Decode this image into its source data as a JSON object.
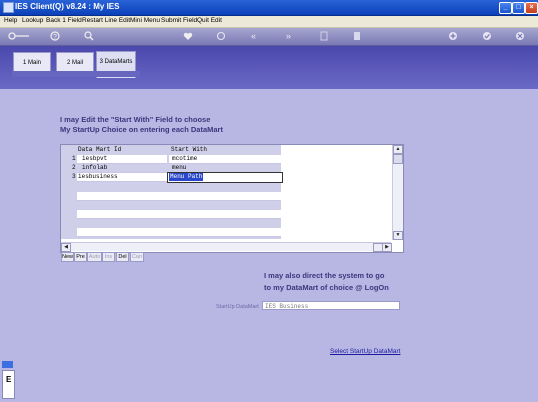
{
  "window": {
    "title": "IES Client(Q) v8.24 : My IES",
    "controls": {
      "minimize": "_",
      "maximize": "□",
      "close": "×"
    }
  },
  "menubar": {
    "items": [
      "Help",
      "Lookup",
      "Back 1 Field",
      "Restart Line Edit",
      "Mini Menu",
      "Submit Field",
      "Quit Edit"
    ]
  },
  "toolbar": {
    "icons": [
      "key-icon",
      "help-icon",
      "search-icon",
      "heart-icon",
      "refresh-icon",
      "rewind-icon",
      "fast-forward-icon",
      "document-icon",
      "clipboard-icon",
      "plus-icon",
      "check-icon",
      "close-icon"
    ]
  },
  "tabs": [
    {
      "label": "1 Main"
    },
    {
      "label": "2 Mail"
    },
    {
      "label": "3 DataMarts",
      "active": true
    }
  ],
  "info": {
    "line1": "I may Edit the \"Start With\" Field to choose",
    "line2": "My StartUp Choice on entering each DataMart"
  },
  "grid": {
    "columns": [
      "Data Mart Id",
      "Start With"
    ],
    "rows": [
      {
        "num": "1",
        "id": "iesbpvt",
        "start_with": "mcotime"
      },
      {
        "num": "2",
        "id": "infolab",
        "start_with": "menu"
      },
      {
        "num": "3",
        "id": "iesbusiness",
        "start_with": "Menu Path"
      }
    ],
    "buttons": [
      "New",
      "Pre",
      "Auto",
      "Ins",
      "Del",
      "Can"
    ]
  },
  "direct": {
    "line1": "I may also direct the system to go",
    "line2": "to my DataMart of choice @ LogOn"
  },
  "startup": {
    "label": "StartUp DataMart",
    "value": "IES Business"
  },
  "link": {
    "label": "Select StartUp DataMart"
  },
  "sidebar": {
    "label": "E"
  }
}
